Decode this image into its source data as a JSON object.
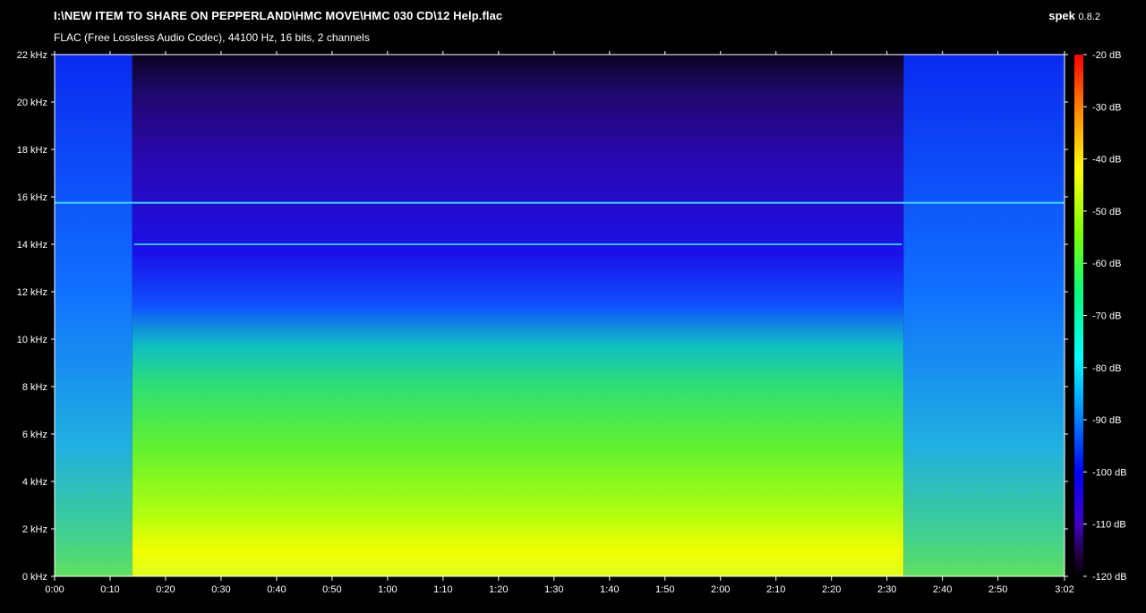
{
  "header": {
    "file_path": "I:\\NEW ITEM TO SHARE ON PEPPERLAND\\HMC MOVE\\HMC 030 CD\\12 Help.flac",
    "file_info": "FLAC (Free Lossless Audio Codec), 44100 Hz, 16 bits, 2 channels",
    "app_name": "spek",
    "app_version": "0.8.2"
  },
  "chart_data": {
    "type": "heatmap",
    "title": "I:\\NEW ITEM TO SHARE ON PEPPERLAND\\HMC MOVE\\HMC 030 CD\\12 Help.flac",
    "subtitle": "FLAC (Free Lossless Audio Codec), 44100 Hz, 16 bits, 2 channels",
    "y_axis": {
      "unit": "kHz",
      "range": [
        0,
        22
      ],
      "ticks": [
        "0 kHz",
        "2 kHz",
        "4 kHz",
        "6 kHz",
        "8 kHz",
        "10 kHz",
        "12 kHz",
        "14 kHz",
        "16 kHz",
        "18 kHz",
        "20 kHz",
        "22 kHz"
      ],
      "tick_values": [
        0,
        2,
        4,
        6,
        8,
        10,
        12,
        14,
        16,
        18,
        20,
        22
      ]
    },
    "x_axis": {
      "unit": "time",
      "range_seconds": [
        0,
        182
      ],
      "ticks": [
        "0:00",
        "0:10",
        "0:20",
        "0:30",
        "0:40",
        "0:50",
        "1:00",
        "1:10",
        "1:20",
        "1:30",
        "1:40",
        "1:50",
        "2:00",
        "2:10",
        "2:20",
        "2:30",
        "2:40",
        "2:50",
        "3:02"
      ],
      "tick_values": [
        0,
        10,
        20,
        30,
        40,
        50,
        60,
        70,
        80,
        90,
        100,
        110,
        120,
        130,
        140,
        150,
        160,
        170,
        182
      ]
    },
    "color_scale": {
      "unit": "dB",
      "range": [
        -120,
        -20
      ],
      "ticks": [
        "-20 dB",
        "-30 dB",
        "-40 dB",
        "-50 dB",
        "-60 dB",
        "-70 dB",
        "-80 dB",
        "-90 dB",
        "-100 dB",
        "-110 dB",
        "-120 dB"
      ],
      "tick_values": [
        -20,
        -30,
        -40,
        -50,
        -60,
        -70,
        -80,
        -90,
        -100,
        -110,
        -120
      ],
      "colors": [
        "#ff0000",
        "#ff8000",
        "#ffff00",
        "#80ff00",
        "#00ff80",
        "#00ffff",
        "#0080ff",
        "#0000ff",
        "#4000c0",
        "#200040",
        "#000000"
      ]
    },
    "notes": {
      "segment_boundaries_seconds": [
        14,
        153
      ],
      "tone_lines_khz": [
        15.75,
        14.0
      ]
    }
  }
}
